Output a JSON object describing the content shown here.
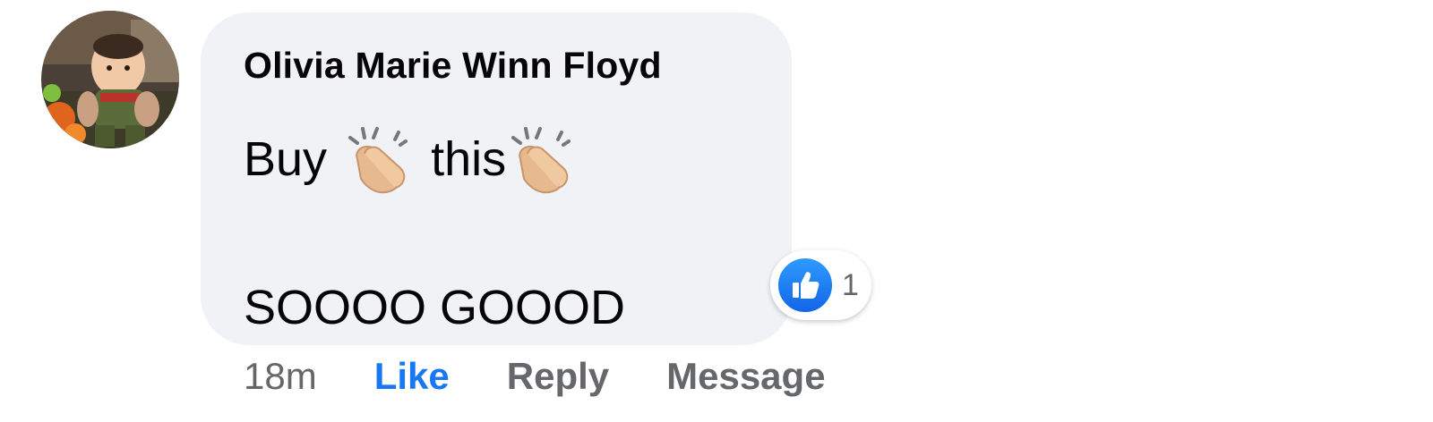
{
  "comment": {
    "author": "Olivia Marie Winn Floyd",
    "text_line1_a": "Buy",
    "text_line1_b": "this",
    "text_line2": "SOOOO GOOOD",
    "emoji": "clapping-hands-icon",
    "reaction": {
      "icon": "like-icon",
      "count": "1",
      "color": "#1877f2"
    }
  },
  "actions": {
    "timestamp": "18m",
    "like_label": "Like",
    "reply_label": "Reply",
    "message_label": "Message"
  },
  "colors": {
    "bubble_bg": "#f0f2f5",
    "text": "#050505",
    "secondary": "#65676b",
    "accent": "#1877f2"
  }
}
